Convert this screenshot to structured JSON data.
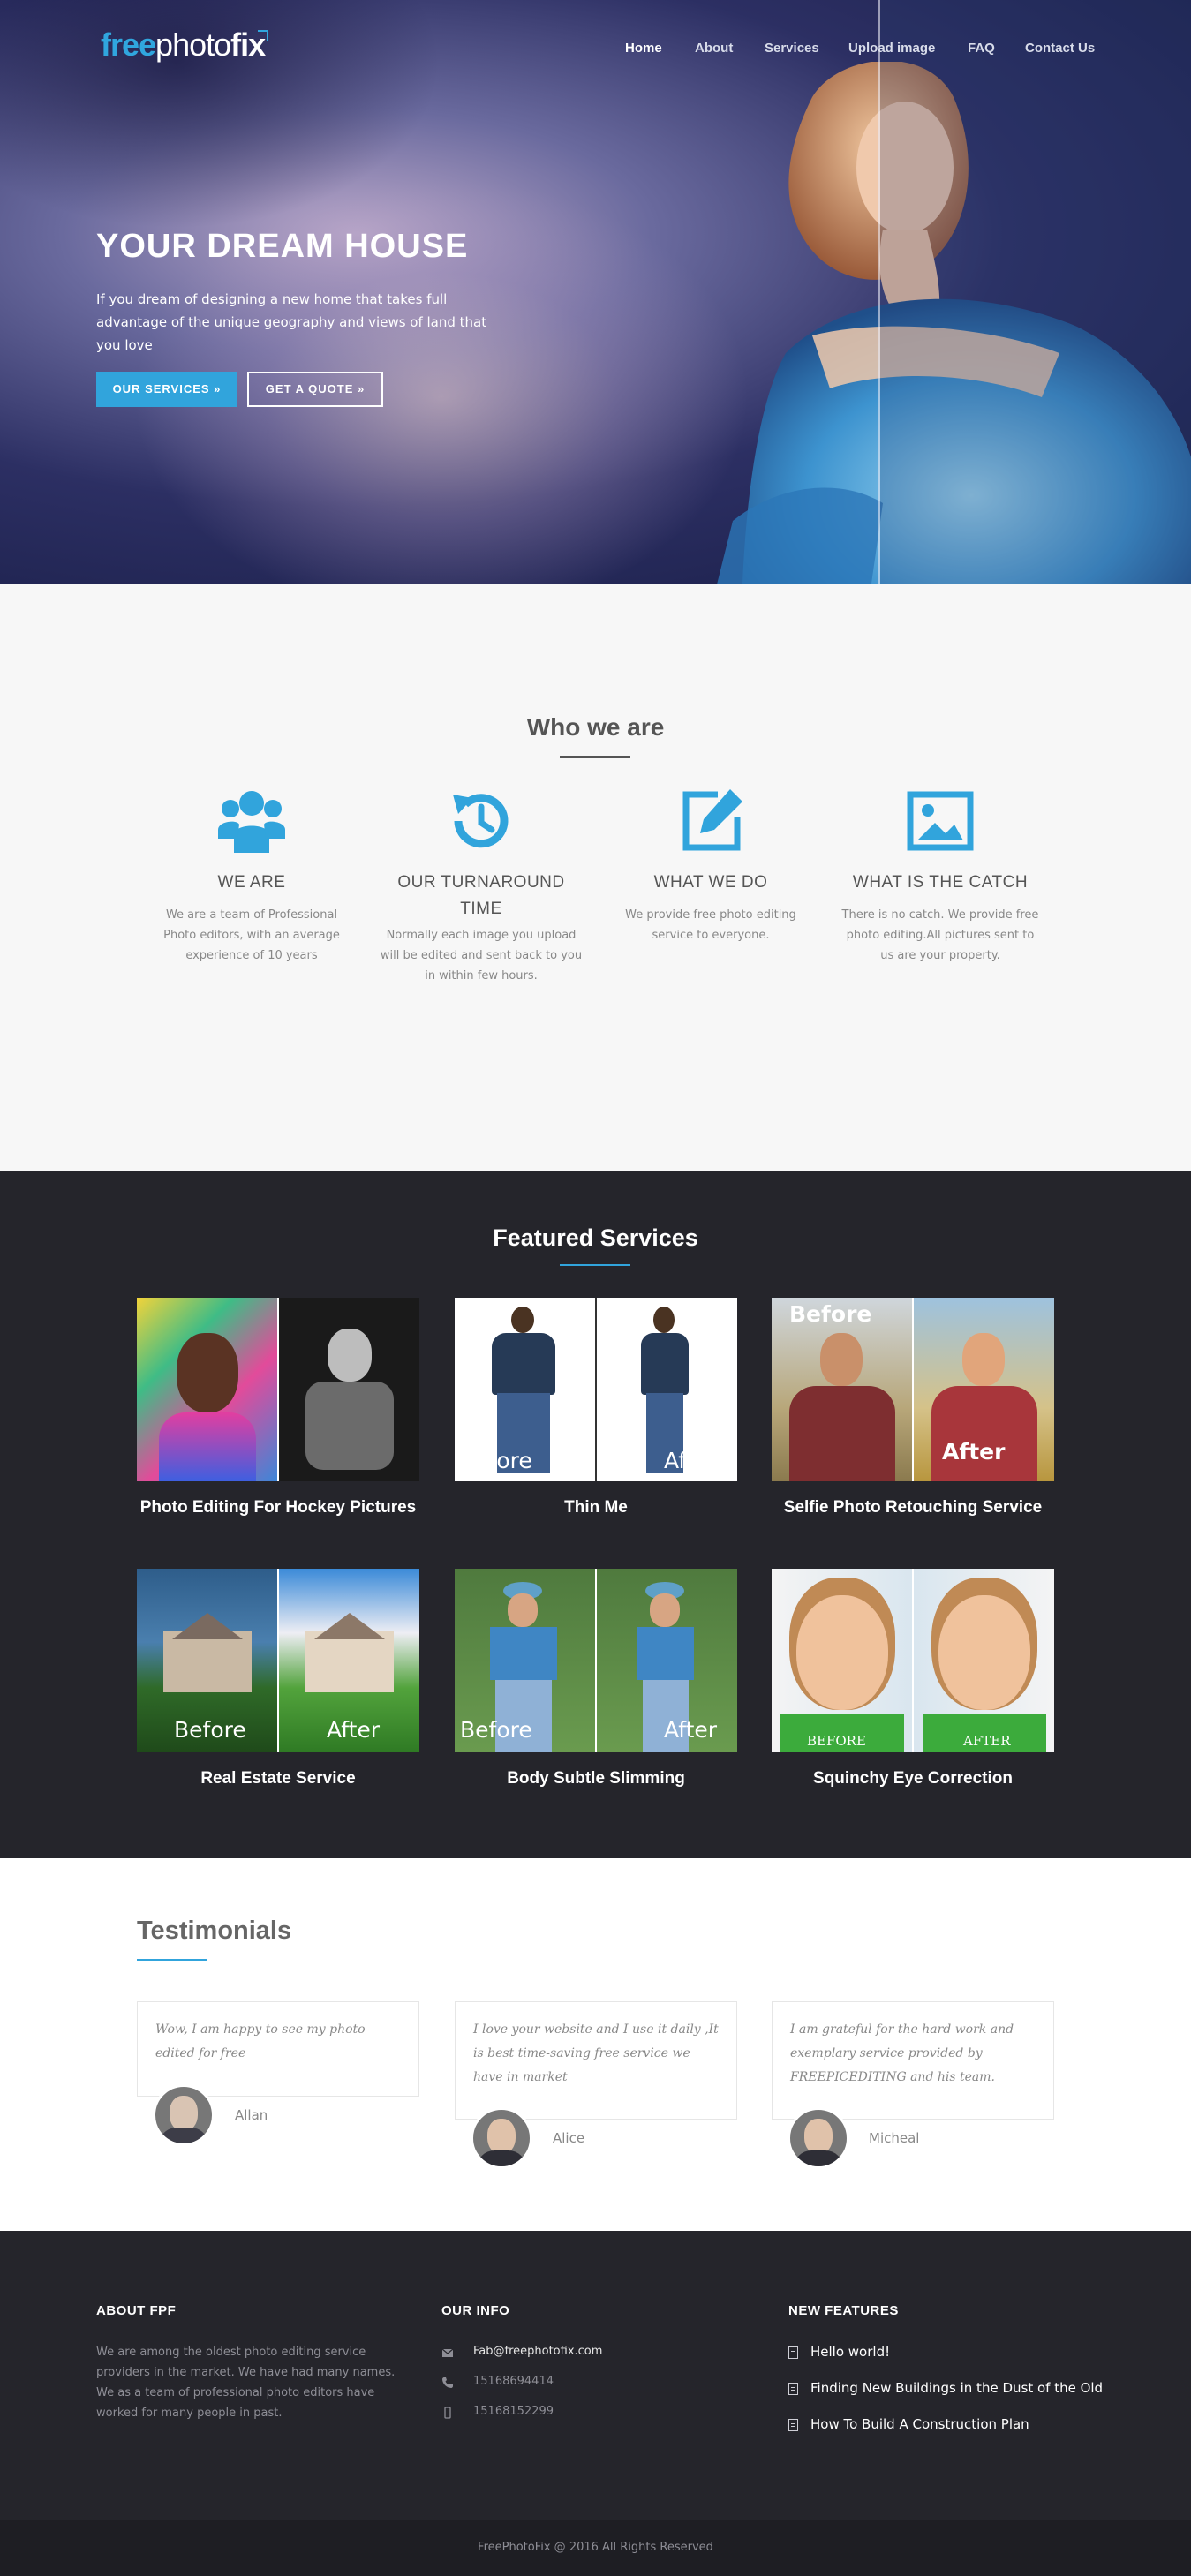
{
  "brand": {
    "part1": "free",
    "part2": "photo",
    "part3": "fix",
    "accent_color": "#30a6de"
  },
  "nav": [
    {
      "label": "Home",
      "active": true
    },
    {
      "label": "About"
    },
    {
      "label": "Services"
    },
    {
      "label": "Upload image"
    },
    {
      "label": "FAQ"
    },
    {
      "label": "Contact Us"
    }
  ],
  "hero": {
    "title": "YOUR DREAM HOUSE",
    "subtitle": "If you dream of designing a new home that takes full advantage of the unique geography and views of land that you love",
    "primary_button": "OUR SERVICES »",
    "secondary_button": "GET A QUOTE »"
  },
  "who": {
    "title": "Who we are",
    "features": [
      {
        "icon": "users-icon",
        "heading": "WE ARE",
        "text": "We are a team of Professional Photo editors, with an average experience of 10 years"
      },
      {
        "icon": "clock-rotate-icon",
        "heading": "OUR TURNAROUND TIME",
        "text": "Normally each image you upload will be edited and sent back to you in within few hours."
      },
      {
        "icon": "edit-icon",
        "heading": "WHAT WE DO",
        "text": "We provide free photo editing service to everyone."
      },
      {
        "icon": "image-icon",
        "heading": "WHAT IS THE CATCH",
        "text": "There is no catch. We provide free photo editing.All pictures sent to us are your property."
      }
    ]
  },
  "featured": {
    "title": "Featured Services",
    "services": [
      {
        "title": "Photo Editing For Hockey Pictures",
        "before_label": "",
        "after_label": ""
      },
      {
        "title": "Thin Me",
        "before_label": "Before",
        "after_label": "After"
      },
      {
        "title": "Selfie Photo Retouching Service",
        "before_label": "Before",
        "after_label": "After"
      },
      {
        "title": "Real Estate Service",
        "before_label": "Before",
        "after_label": "After"
      },
      {
        "title": "Body Subtle Slimming",
        "before_label": "Before",
        "after_label": "After"
      },
      {
        "title": "Squinchy Eye Correction",
        "before_label": "BEFORE",
        "after_label": "AFTER"
      }
    ]
  },
  "testimonials": {
    "title": "Testimonials",
    "items": [
      {
        "quote": "Wow, I am happy to see my photo edited for free",
        "name": "Allan"
      },
      {
        "quote": "I love your website and I use it daily ,It is best time-saving free service we have in market",
        "name": "Alice"
      },
      {
        "quote": "I am grateful for the hard work and exemplary service provided by FREEPICEDITING and his team.",
        "name": "Micheal"
      }
    ]
  },
  "footer": {
    "about_title": "ABOUT FPF",
    "about_text": "We are among the oldest photo editing service providers in the market. We have had many names. We as a team of professional photo editors have worked for many people in past.",
    "info_title": "OUR INFO",
    "email": "Fab@freephotofix.com",
    "phone": "15168694414",
    "mobile": "15168152299",
    "features_title": "NEW FEATURES",
    "features": [
      "Hello world!",
      "Finding New Buildings in the Dust of the Old",
      "How To Build A Construction Plan"
    ],
    "copyright": "FreePhotoFix @ 2016  All Rights Reserved"
  }
}
